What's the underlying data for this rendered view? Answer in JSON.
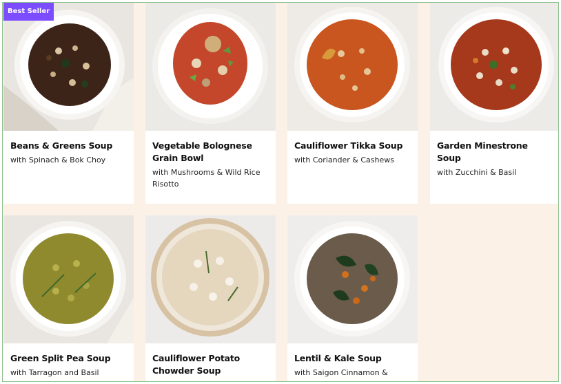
{
  "badge": {
    "best_seller": "Best Seller"
  },
  "products": [
    {
      "title": "Beans & Greens Soup",
      "subtitle": "with Spinach & Bok Choy",
      "image": "beans-greens-soup-bowl"
    },
    {
      "title": "Vegetable Bolognese Grain Bowl",
      "subtitle": "with Mushrooms & Wild Rice Risotto",
      "image": "vegetable-bolognese-bowl"
    },
    {
      "title": "Cauliflower Tikka Soup",
      "subtitle": "with Coriander & Cashews",
      "image": "cauliflower-tikka-soup-bowl"
    },
    {
      "title": "Garden Minestrone Soup",
      "subtitle": "with Zucchini & Basil",
      "image": "garden-minestrone-soup-bowl"
    },
    {
      "title": "Green Split Pea Soup",
      "subtitle": "with Tarragon and Basil",
      "image": "green-split-pea-soup-bowl"
    },
    {
      "title": "Cauliflower Potato Chowder Soup",
      "subtitle": "",
      "image": "cauliflower-potato-chowder-bowl"
    },
    {
      "title": "Lentil & Kale Soup",
      "subtitle": "with Saigon Cinnamon & Rosemary",
      "image": "lentil-kale-soup-bowl"
    }
  ],
  "colors": {
    "badge": "#7c4dff",
    "page_background": "#fbf1e7",
    "card_background": "#ffffff"
  }
}
